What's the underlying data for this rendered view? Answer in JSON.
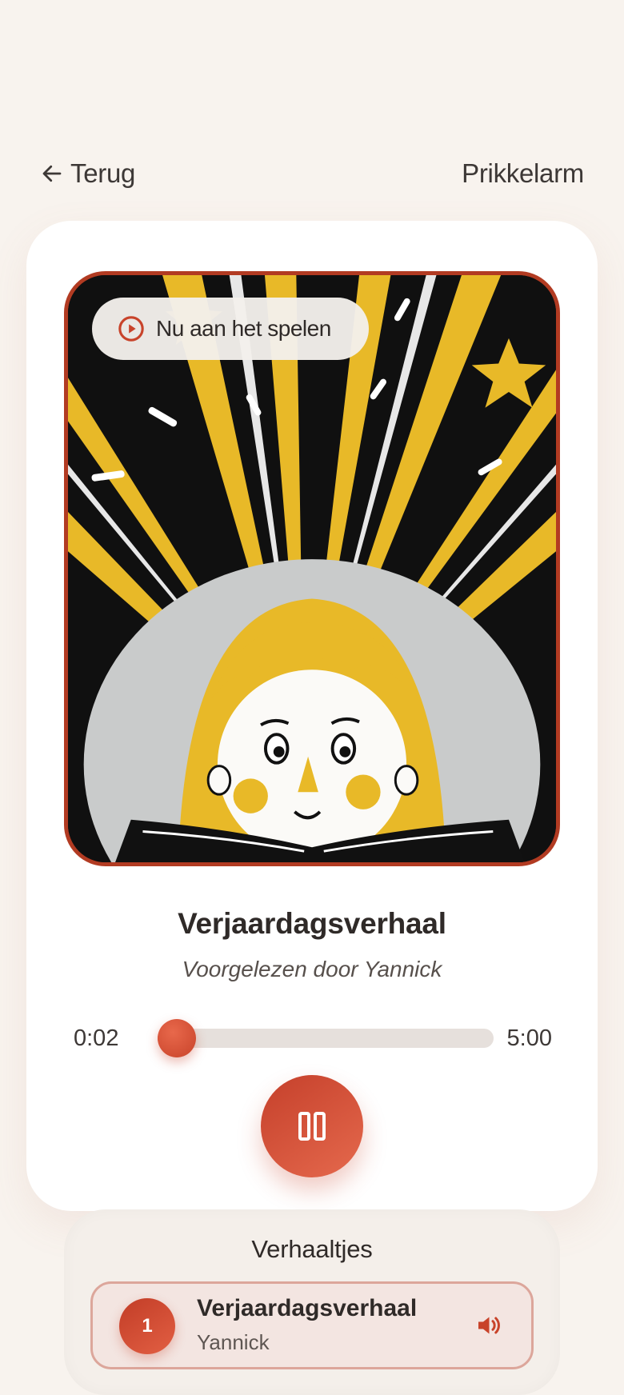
{
  "header": {
    "back_label": "Terug",
    "brand": "Prikkelarm"
  },
  "player": {
    "badge": "Nu aan het spelen",
    "title": "Verjaardagsverhaal",
    "narrator": "Voorgelezen door Yannick",
    "time_elapsed": "0:02",
    "time_total": "5:00",
    "progress": 0.0067,
    "state_icon": "pause-icon"
  },
  "playlist": {
    "heading": "Verhaaltjes",
    "items": [
      {
        "number": "1",
        "title": "Verjaardagsverhaal",
        "narrator": "Yannick",
        "icon": "speaker-icon"
      }
    ]
  },
  "colors": {
    "accent": "#d04d35",
    "background": "#f8f3ee",
    "card": "#ffffff",
    "art_yellow": "#e8b928"
  }
}
